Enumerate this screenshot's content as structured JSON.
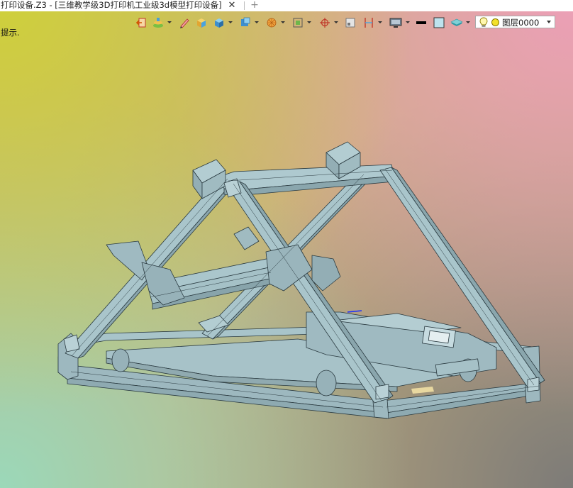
{
  "tab": {
    "title": "打印设备.Z3 - [三维教学级3D打印机工业级3d模型打印设备]",
    "close_glyph": "✕",
    "add_glyph": "+"
  },
  "hint": "提示.",
  "toolbar": {
    "buttons": [
      {
        "icon": "exit-icon"
      },
      {
        "icon": "tree-layers-icon"
      },
      {
        "icon": "pencil-icon"
      },
      {
        "icon": "box-shade-icon"
      },
      {
        "icon": "cube-icon"
      },
      {
        "icon": "view-cube-icon"
      },
      {
        "icon": "render-sphere-icon"
      },
      {
        "icon": "orient-frame-icon"
      },
      {
        "icon": "target-icon"
      },
      {
        "icon": "small-window-icon"
      },
      {
        "icon": "measure-icon"
      },
      {
        "icon": "monitor-icon"
      },
      {
        "icon": "line-color-icon"
      },
      {
        "icon": "face-color-icon"
      },
      {
        "icon": "layer-stack-icon"
      }
    ],
    "colors": {
      "line": "#000000",
      "face": "#bde3ee"
    }
  },
  "layer_dropdown": {
    "value": "图层0000",
    "icons": [
      "bulb-icon",
      "layer-color-dot-icon"
    ]
  },
  "model": {
    "icon": "3d-printer-model",
    "fill": "#a3c0c7",
    "stroke": "#2a3a40"
  }
}
